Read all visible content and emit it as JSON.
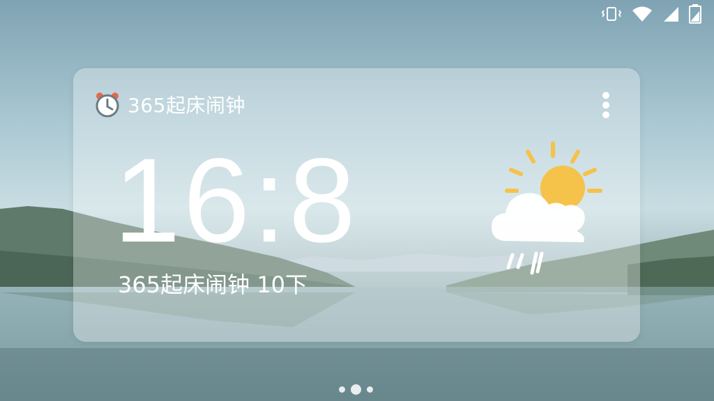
{
  "widget": {
    "app_name": "365起床闹钟",
    "time": "16:8",
    "subtitle": "365起床闹钟 10下",
    "weather_icon": "partly-cloudy-rain-icon",
    "menu_icon": "more-vertical-icon"
  },
  "status_bar": {
    "icons": [
      "vibrate-icon",
      "wifi-icon",
      "signal-icon",
      "battery-icon"
    ]
  },
  "home": {
    "page_count": 3,
    "active_page": 2
  },
  "colors": {
    "sun": "#f5c24a",
    "text": "#ffffff",
    "clock_accent": "#e9674a"
  }
}
